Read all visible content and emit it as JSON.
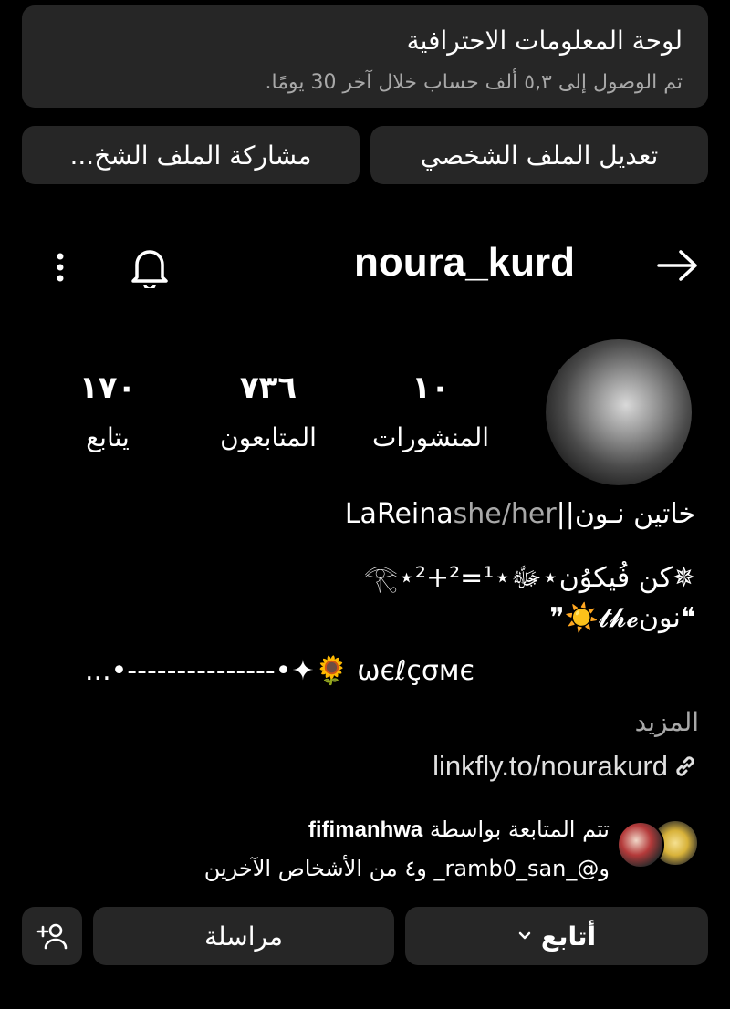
{
  "dashboard": {
    "title": "لوحة المعلومات الاحترافية",
    "subtitle": "تم الوصول إلى ٥,٣ ألف حساب خلال آخر 30 يومًا."
  },
  "actions": {
    "edit_profile": "تعديل الملف الشخصي",
    "share_profile": "مشاركة الملف الشخ..."
  },
  "header": {
    "username": "noura_kurd"
  },
  "stats": {
    "posts": {
      "value": "١٠",
      "label": "المنشورات"
    },
    "followers": {
      "value": "٧٣٦",
      "label": "المتابعون"
    },
    "following": {
      "value": "١٧٠",
      "label": "يتابع"
    }
  },
  "bio": {
    "line1_name": "خاتين نـون||LaReina",
    "line1_pronouns": "she/her",
    "line2": "✵كن فُيكوُن⋆ﷻ⋆¹=²+²⋆𓂀",
    "line3": "❝نون𝓽𝓱𝓮☀️❞",
    "line4": "...•---------------•✦🌻 ωєℓçσмє",
    "more": "المزيد",
    "link": "linkfly.to/nourakurd"
  },
  "followed_by": {
    "prefix": "تتم المتابعة بواسطة",
    "user1": "fifimanhwa",
    "line2": "و@_ramb0_san_ و٤ من الأشخاص الآخرين"
  },
  "buttons": {
    "follow": "أتابع",
    "message": "مراسلة"
  },
  "icons": {
    "back": "arrow-right-icon",
    "bell": "bell-icon",
    "more": "more-vertical-icon",
    "link": "link-icon",
    "chevron": "chevron-down-icon",
    "add_user": "add-user-icon"
  }
}
